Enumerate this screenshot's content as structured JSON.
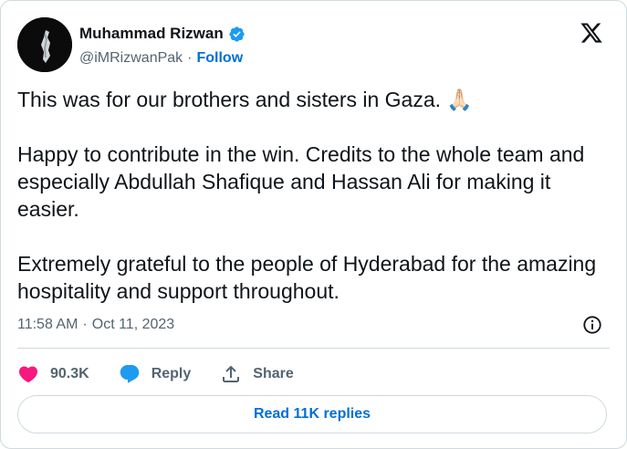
{
  "author": {
    "name": "Muhammad Rizwan",
    "handle": "@iMRizwanPak",
    "separator": "·",
    "follow_label": "Follow"
  },
  "tweet": {
    "paragraphs": [
      "This was for our brothers and sisters in Gaza. 🙏🏻",
      "Happy to contribute in the win. Credits to the whole team and especially Abdullah Shafique and Hassan Ali for making it easier.",
      "Extremely grateful to the people of Hyderabad for the amazing hospitality and support throughout."
    ],
    "time": "11:58 AM",
    "date": "Oct 11, 2023",
    "meta_separator": "·"
  },
  "actions": {
    "likes": "90.3K",
    "reply_label": "Reply",
    "share_label": "Share"
  },
  "read_replies_label": "Read 11K replies",
  "icons": {
    "avatar": "avatar-silhouette",
    "verified": "verified-badge-icon",
    "logo": "x-logo-icon",
    "info": "info-icon",
    "like": "heart-icon",
    "reply": "speech-bubble-icon",
    "share": "share-upload-icon"
  },
  "colors": {
    "accent": "#1d9bf0",
    "link": "#006fd6",
    "like": "#f91880",
    "secondary_text": "#536471",
    "border": "#cfd9de"
  }
}
